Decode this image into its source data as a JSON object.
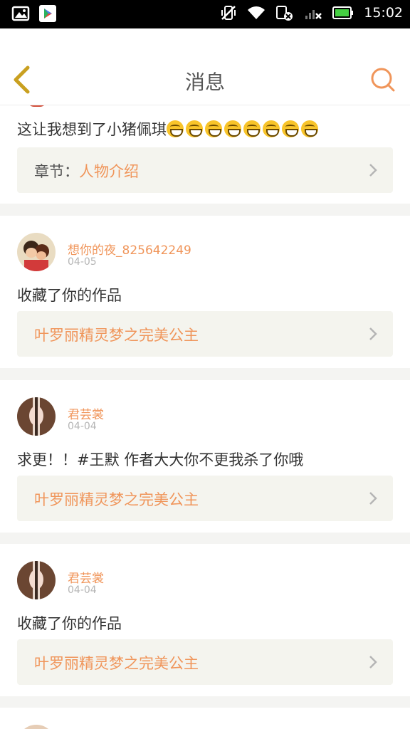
{
  "status_bar": {
    "time": "15:02",
    "left_icons": [
      "gallery-icon",
      "play-store-icon"
    ],
    "right_icons": [
      "mute-vibrate-icon",
      "wifi-icon",
      "sim-blocked-icon",
      "signal-icon",
      "battery-icon"
    ]
  },
  "header": {
    "title": "消息",
    "back_icon": "chevron-left-icon",
    "search_icon": "search-icon",
    "accent_color": "#f0955a"
  },
  "messages": [
    {
      "text": "这让我想到了小猪佩琪",
      "emoji_count": 8,
      "link_prefix": "章节：",
      "link_label": "人物介绍"
    },
    {
      "username": "想你的夜_825642249",
      "date": "04-05",
      "text": "收藏了你的作品",
      "link_label": "叶罗丽精灵梦之完美公主"
    },
    {
      "username": "君芸裳",
      "date": "04-04",
      "text": "求更！！#王默 作者大大你不更我杀了你哦",
      "link_label": "叶罗丽精灵梦之完美公主"
    },
    {
      "username": "君芸裳",
      "date": "04-04",
      "text": "收藏了你的作品",
      "link_label": "叶罗丽精灵梦之完美公主"
    }
  ]
}
